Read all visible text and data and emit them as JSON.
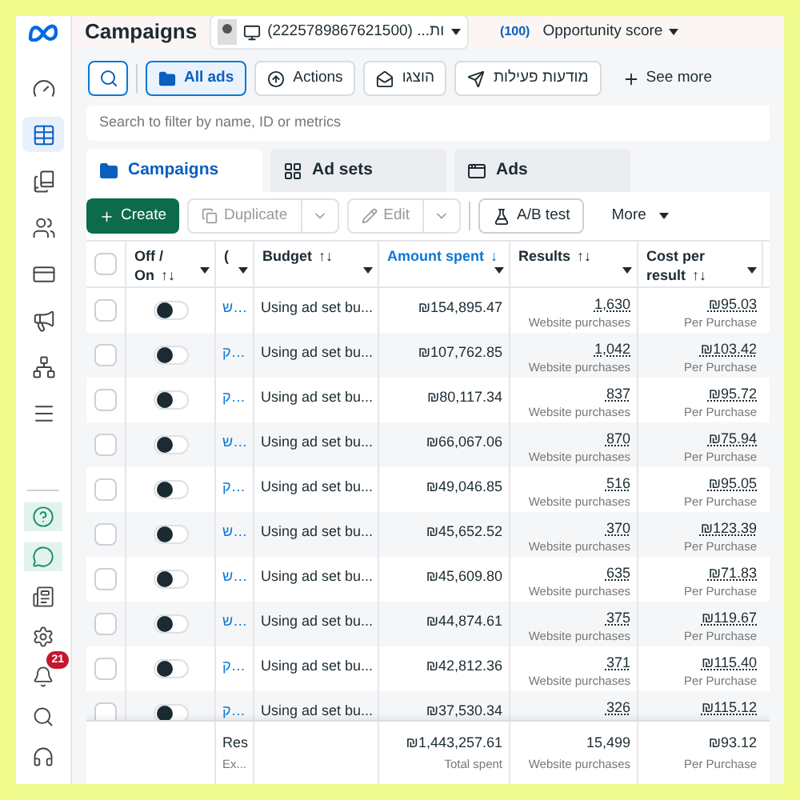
{
  "header": {
    "title": "Campaigns",
    "account": "(2225789867621500) ...ות",
    "score_badge": "(100)",
    "score_label": "Opportunity score"
  },
  "sidebar": {
    "items": [
      {
        "selected": false
      },
      {
        "selected": true
      },
      {
        "selected": false
      },
      {
        "selected": false
      },
      {
        "selected": false
      },
      {
        "selected": false
      },
      {
        "selected": false
      },
      {
        "selected": false
      }
    ],
    "notification_badge": "21"
  },
  "toolbar": [
    {
      "kind": "folder",
      "label": "All ads",
      "selected": true
    },
    {
      "kind": "upload",
      "label": "Actions",
      "selected": false
    },
    {
      "kind": "mail",
      "label": "הוצגו",
      "selected": false
    },
    {
      "kind": "send",
      "label": "מודעות פעילות",
      "selected": false
    }
  ],
  "see_more": "See more",
  "filter": {
    "placeholder": "Search to filter by name, ID or metrics"
  },
  "tabs": [
    {
      "label": "Campaigns",
      "selected": true
    },
    {
      "label": "Ad sets",
      "selected": false
    },
    {
      "label": "Ads",
      "selected": false
    }
  ],
  "actions": {
    "create": "Create",
    "duplicate": "Duplicate",
    "edit": "Edit",
    "ab_test": "A/B test",
    "more": "More"
  },
  "table": {
    "select_all_checked": false,
    "columns": [
      {
        "label": "Off / On",
        "sort": "↑↓",
        "active": false
      },
      {
        "label": "(",
        "active": false
      },
      {
        "label": "Budget",
        "sort": "↑↓",
        "active": false
      },
      {
        "label": "Amount spent",
        "sort": "↓",
        "active": true
      },
      {
        "label": "Results",
        "sort": "↑↓",
        "active": false
      },
      {
        "label": "Cost per result",
        "sort": "↑↓",
        "active": false
      }
    ],
    "rows": [
      {
        "checked": false,
        "on": false,
        "name": "ש…",
        "budget": "Using ad set bu...",
        "spent": "₪154,895.47",
        "results": "1,630",
        "results_label": "Website purchases",
        "cost": "₪95.03",
        "cost_label": "Per Purchase"
      },
      {
        "checked": false,
        "on": false,
        "name": "ק…",
        "budget": "Using ad set bu...",
        "spent": "₪107,762.85",
        "results": "1,042",
        "results_label": "Website purchases",
        "cost": "₪103.42",
        "cost_label": "Per Purchase"
      },
      {
        "checked": false,
        "on": false,
        "name": "ק…",
        "budget": "Using ad set bu...",
        "spent": "₪80,117.34",
        "results": "837",
        "results_label": "Website purchases",
        "cost": "₪95.72",
        "cost_label": "Per Purchase"
      },
      {
        "checked": false,
        "on": false,
        "name": "ש…",
        "budget": "Using ad set bu...",
        "spent": "₪66,067.06",
        "results": "870",
        "results_label": "Website purchases",
        "cost": "₪75.94",
        "cost_label": "Per Purchase"
      },
      {
        "checked": false,
        "on": false,
        "name": "ק…",
        "budget": "Using ad set bu...",
        "spent": "₪49,046.85",
        "results": "516",
        "results_label": "Website purchases",
        "cost": "₪95.05",
        "cost_label": "Per Purchase"
      },
      {
        "checked": false,
        "on": false,
        "name": "ש…",
        "budget": "Using ad set bu...",
        "spent": "₪45,652.52",
        "results": "370",
        "results_label": "Website purchases",
        "cost": "₪123.39",
        "cost_label": "Per Purchase"
      },
      {
        "checked": false,
        "on": false,
        "name": "ש…",
        "budget": "Using ad set bu...",
        "spent": "₪45,609.80",
        "results": "635",
        "results_label": "Website purchases",
        "cost": "₪71.83",
        "cost_label": "Per Purchase"
      },
      {
        "checked": false,
        "on": false,
        "name": "ש…",
        "budget": "Using ad set bu...",
        "spent": "₪44,874.61",
        "results": "375",
        "results_label": "Website purchases",
        "cost": "₪119.67",
        "cost_label": "Per Purchase"
      },
      {
        "checked": false,
        "on": false,
        "name": "ק…",
        "budget": "Using ad set bu...",
        "spent": "₪42,812.36",
        "results": "371",
        "results_label": "Website purchases",
        "cost": "₪115.40",
        "cost_label": "Per Purchase"
      },
      {
        "checked": false,
        "on": false,
        "name": "ק…",
        "budget": "Using ad set bu...",
        "spent": "₪37,530.34",
        "results": "326",
        "cost": "₪115.12"
      }
    ],
    "footer": {
      "name": "Res",
      "name_sub": "Ex...",
      "spent": "₪1,443,257.61",
      "spent_label": "Total spent",
      "results": "15,499",
      "results_label": "Website purchases",
      "cost": "₪93.12",
      "cost_label": "Per Purchase"
    }
  }
}
